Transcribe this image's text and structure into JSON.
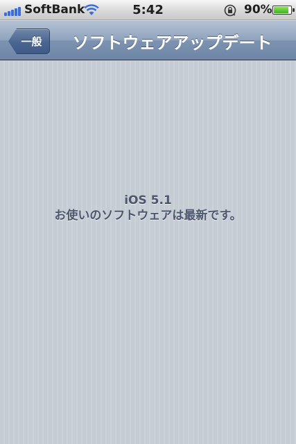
{
  "status_bar": {
    "carrier": "SoftBank",
    "time": "5:42",
    "battery_percent": "90%",
    "battery_level": 0.9,
    "icons": [
      "signal-icon",
      "wifi-icon",
      "orientation-lock-icon",
      "battery-icon"
    ]
  },
  "nav_bar": {
    "back_label": "一般",
    "title": "ソフトウェアアップデート"
  },
  "content": {
    "version": "iOS 5.1",
    "status_message": "お使いのソフトウェアは最新です。"
  },
  "colors": {
    "nav_bar": "#7d93b1",
    "background": "#c5ccd4",
    "message_text": "#4c566c",
    "signal": "#3b6ed8",
    "battery_fill": "#3fb21c"
  }
}
